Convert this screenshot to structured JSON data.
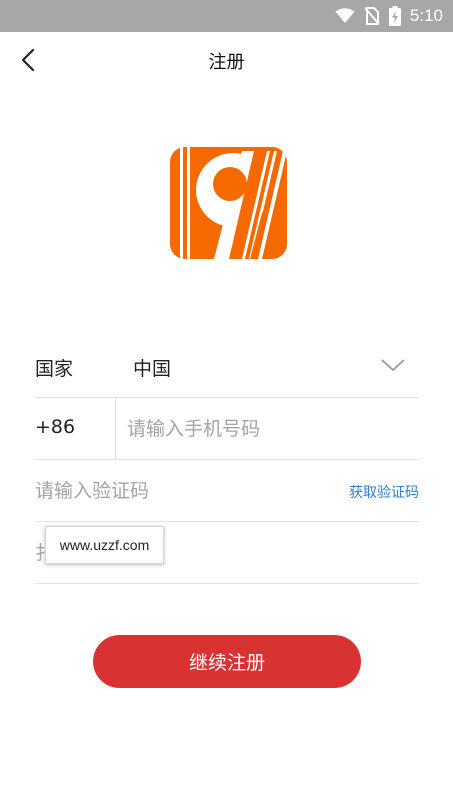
{
  "status_bar": {
    "time": "5:10",
    "icons": [
      "wifi-icon",
      "no-sim-icon",
      "battery-charging-icon"
    ]
  },
  "header": {
    "title": "注册",
    "back_icon": "chevron-left-icon"
  },
  "logo": {
    "icon": "app-logo-9-icon",
    "brand_color": "#f56a00"
  },
  "form": {
    "country": {
      "label": "国家",
      "value": "中国",
      "dropdown_icon": "chevron-down-icon"
    },
    "phone": {
      "code": "+86",
      "placeholder": "请输入手机号码"
    },
    "verification": {
      "placeholder": "请输入验证码",
      "get_code_label": "获取验证码"
    },
    "password": {
      "placeholder": "扌"
    },
    "watermark": "www.uzzf.com"
  },
  "submit": {
    "label": "继续注册",
    "color": "#d93232"
  }
}
